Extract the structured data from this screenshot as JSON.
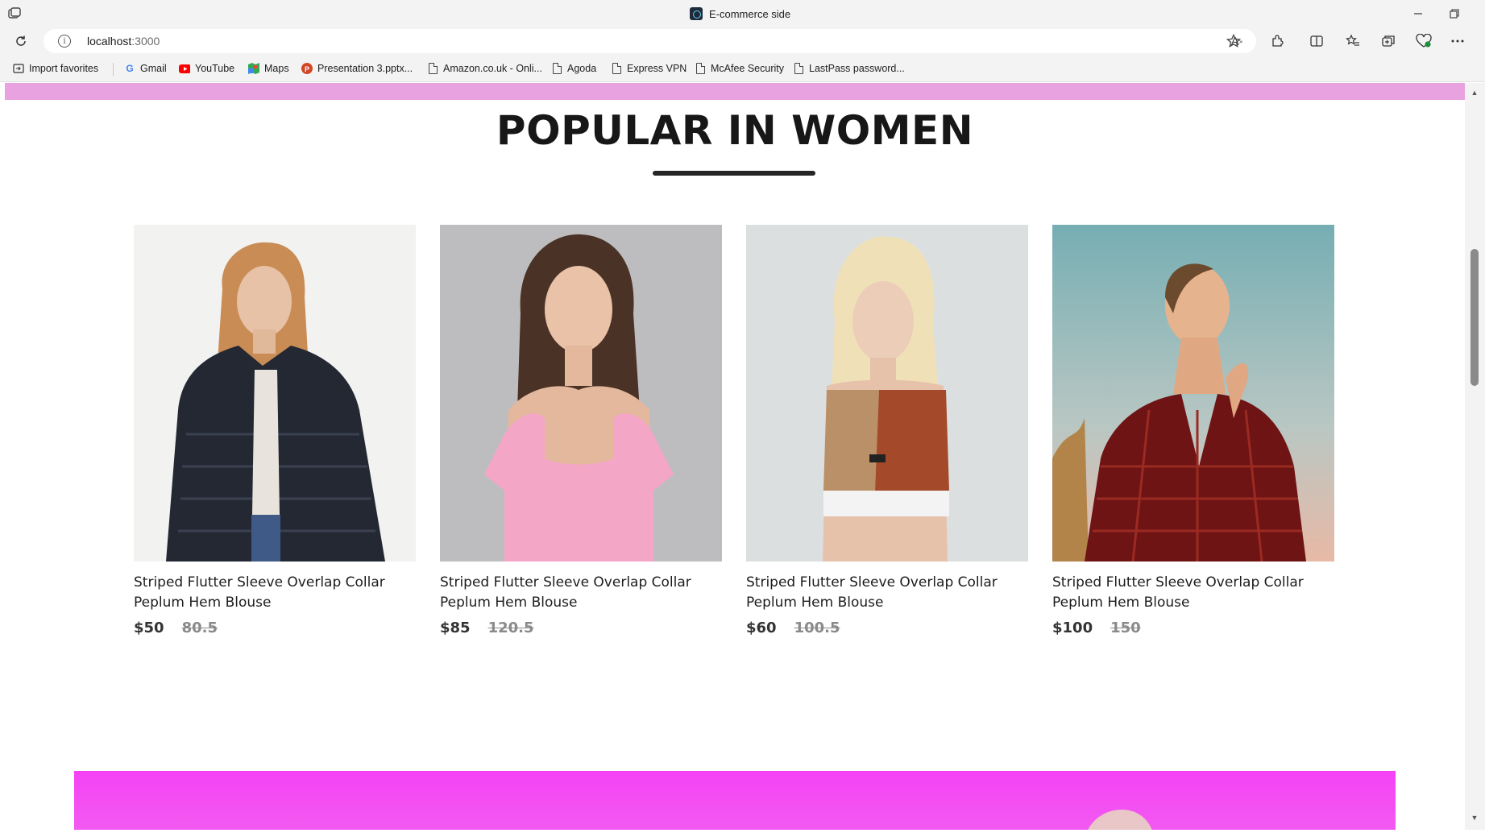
{
  "browser": {
    "tab_title": "E-commerce side",
    "address": {
      "host": "localhost",
      "port": ":3000"
    },
    "window_controls": [
      "minimize",
      "restore"
    ],
    "bookmarks": [
      {
        "label": "Import favorites",
        "icon": "import-icon"
      },
      {
        "label": "Gmail",
        "icon": "gmail-icon"
      },
      {
        "label": "YouTube",
        "icon": "youtube-icon"
      },
      {
        "label": "Maps",
        "icon": "maps-icon"
      },
      {
        "label": "Presentation 3.pptx...",
        "icon": "powerpoint-icon"
      },
      {
        "label": "Amazon.co.uk - Onli...",
        "icon": "page-icon"
      },
      {
        "label": "Agoda",
        "icon": "page-icon"
      },
      {
        "label": "Express VPN",
        "icon": "page-icon"
      },
      {
        "label": "McAfee Security",
        "icon": "page-icon"
      },
      {
        "label": "LastPass password...",
        "icon": "page-icon"
      }
    ]
  },
  "page": {
    "section_title": "POPULAR IN WOMEN",
    "colors": {
      "top_band": "#e8a2e0",
      "promo_banner": "#f542f5",
      "title_rule": "#252525"
    },
    "products": [
      {
        "name": "Striped Flutter Sleeve Overlap Collar Peplum Hem Blouse",
        "new_price": "$50",
        "old_price": "80.5",
        "image": "woman in dark fur jacket"
      },
      {
        "name": "Striped Flutter Sleeve Overlap Collar Peplum Hem Blouse",
        "new_price": "$85",
        "old_price": "120.5",
        "image": "woman in pink top"
      },
      {
        "name": "Striped Flutter Sleeve Overlap Collar Peplum Hem Blouse",
        "new_price": "$60",
        "old_price": "100.5",
        "image": "woman in sports crop top"
      },
      {
        "name": "Striped Flutter Sleeve Overlap Collar Peplum Hem Blouse",
        "new_price": "$100",
        "old_price": "150",
        "image": "woman in red patterned dress"
      }
    ]
  }
}
